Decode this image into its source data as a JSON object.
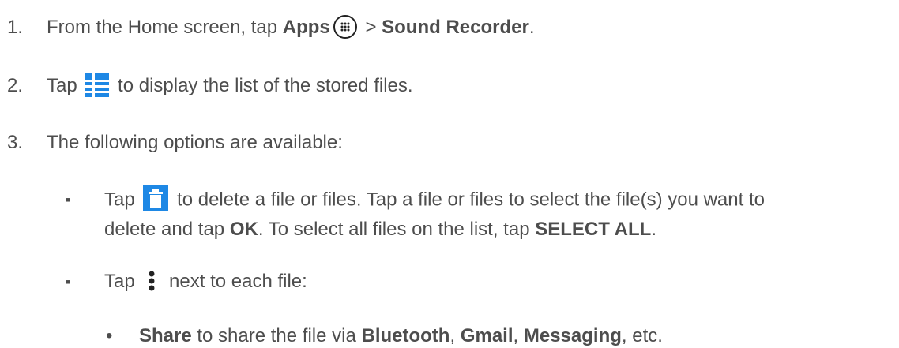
{
  "step1": {
    "number": "1.",
    "text_a": "From the Home screen, tap ",
    "bold_apps": "Apps",
    "text_b": " > ",
    "bold_sound": "Sound Recorder",
    "text_c": "."
  },
  "step2": {
    "number": "2.",
    "text_a": "Tap ",
    "text_b": " to display the list of the stored files."
  },
  "step3": {
    "number": "3.",
    "text": "The following options are available:"
  },
  "bullet1": {
    "marker": "▪",
    "text_a": "Tap ",
    "text_b": " to delete a file or files. Tap a file or files to select the file(s) you want to",
    "line2_a": "delete and tap ",
    "bold_ok": "OK",
    "line2_b": ". To select all files on the list, tap ",
    "bold_select_all": "SELECT ALL",
    "line2_c": "."
  },
  "bullet2": {
    "marker": "▪",
    "text_a": "Tap ",
    "text_b": " next to each file:"
  },
  "sub_bullet1": {
    "marker": "•",
    "bold_share": "Share",
    "text_a": " to share the file via ",
    "bold_bluetooth": "Bluetooth",
    "sep1": ", ",
    "bold_gmail": "Gmail",
    "sep2": ", ",
    "bold_messaging": "Messaging",
    "text_b": ", etc."
  },
  "icons": {
    "apps": "apps-grid-icon",
    "list": "list-view-icon",
    "delete": "trash-icon",
    "menu": "overflow-menu-icon"
  },
  "colors": {
    "text": "#4d4d4d",
    "icon_blue": "#1e88e5",
    "icon_dark": "#222222"
  }
}
